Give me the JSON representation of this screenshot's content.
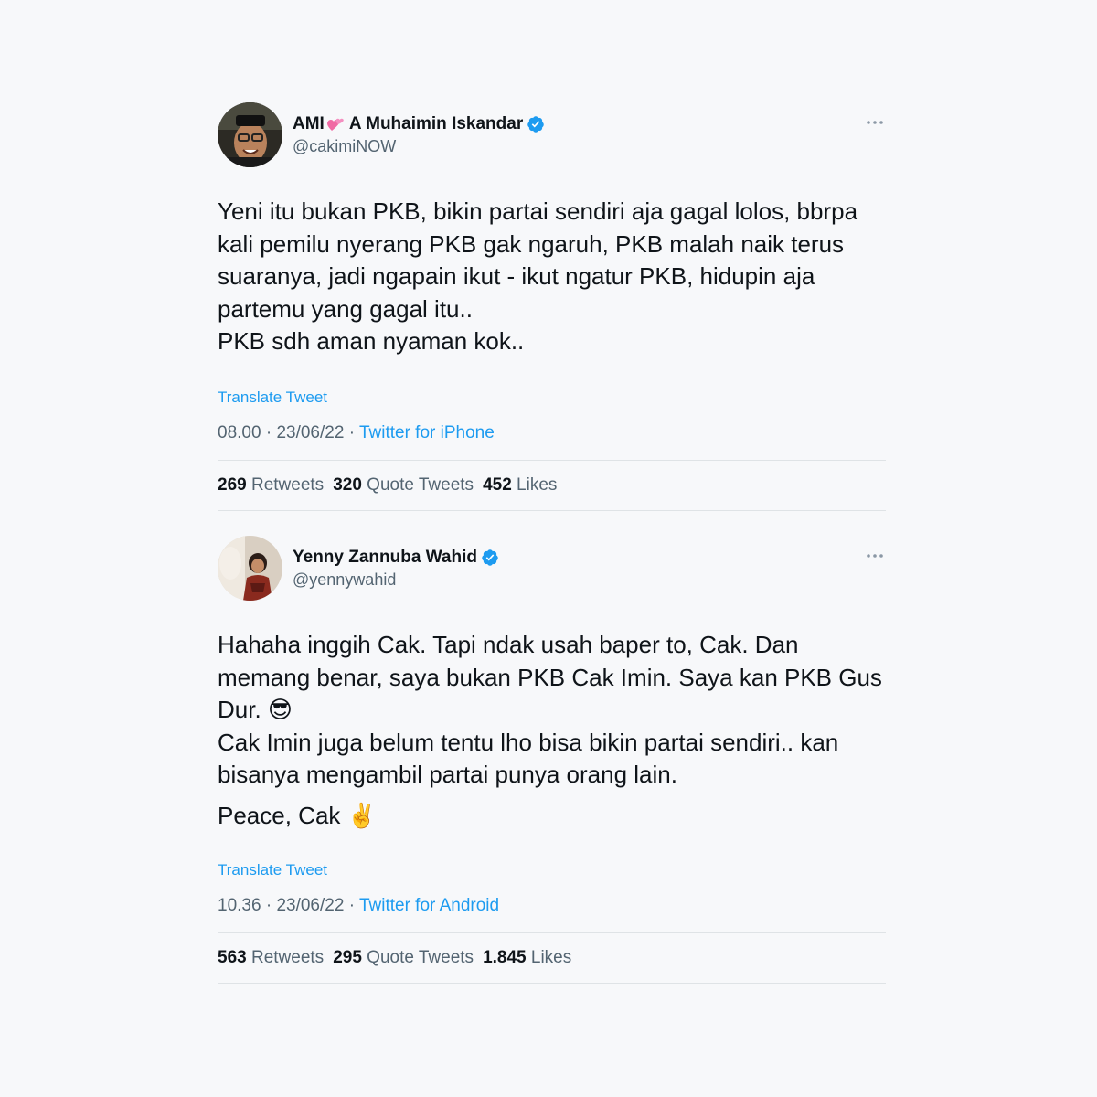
{
  "tweets": [
    {
      "display_name": "AMI",
      "display_name_rest": "A Muhaimin Iskandar",
      "handle": "@cakimiNOW",
      "verified": true,
      "text_lines": [
        "Yeni itu bukan PKB, bikin partai sendiri aja gagal lolos, bbrpa kali pemilu nyerang PKB gak ngaruh, PKB malah naik terus suaranya, jadi ngapain ikut - ikut ngatur PKB, hidupin aja partemu yang gagal itu..",
        "PKB sdh aman nyaman kok.."
      ],
      "translate_label": "Translate Tweet",
      "time": "08.00",
      "date": "23/06/22",
      "source": "Twitter for iPhone",
      "retweets_count": "269",
      "retweets_label": "Retweets",
      "quotes_count": "320",
      "quotes_label": "Quote Tweets",
      "likes_count": "452",
      "likes_label": "Likes"
    },
    {
      "display_name": "Yenny Zannuba Wahid",
      "handle": "@yennywahid",
      "verified": true,
      "text_line_1": "Hahaha inggih Cak. Tapi ndak usah baper to, Cak. Dan memang benar, saya bukan PKB Cak Imin. Saya kan PKB Gus Dur.",
      "text_line_1_emoji": "😎",
      "text_line_2": "Cak Imin juga belum tentu lho bisa bikin partai sendiri.. kan bisanya mengambil  partai punya orang lain.",
      "text_line_3": "Peace, Cak",
      "text_line_3_emoji": "✌️",
      "translate_label": "Translate Tweet",
      "time": "10.36",
      "date": "23/06/22",
      "source": "Twitter for Android",
      "retweets_count": "563",
      "retweets_label": "Retweets",
      "quotes_count": "295",
      "quotes_label": "Quote Tweets",
      "likes_count": "1.845",
      "likes_label": "Likes"
    }
  ],
  "colors": {
    "background": "#f7f8fa",
    "text": "#0f1419",
    "secondary": "#536471",
    "link": "#1d9bf0",
    "divider": "#dfe3e6",
    "verified": "#1d9bf0"
  },
  "icons": {
    "verified": "verified-badge-icon",
    "more": "more-dots-icon",
    "name_emoji": "two-hearts-emoji"
  }
}
